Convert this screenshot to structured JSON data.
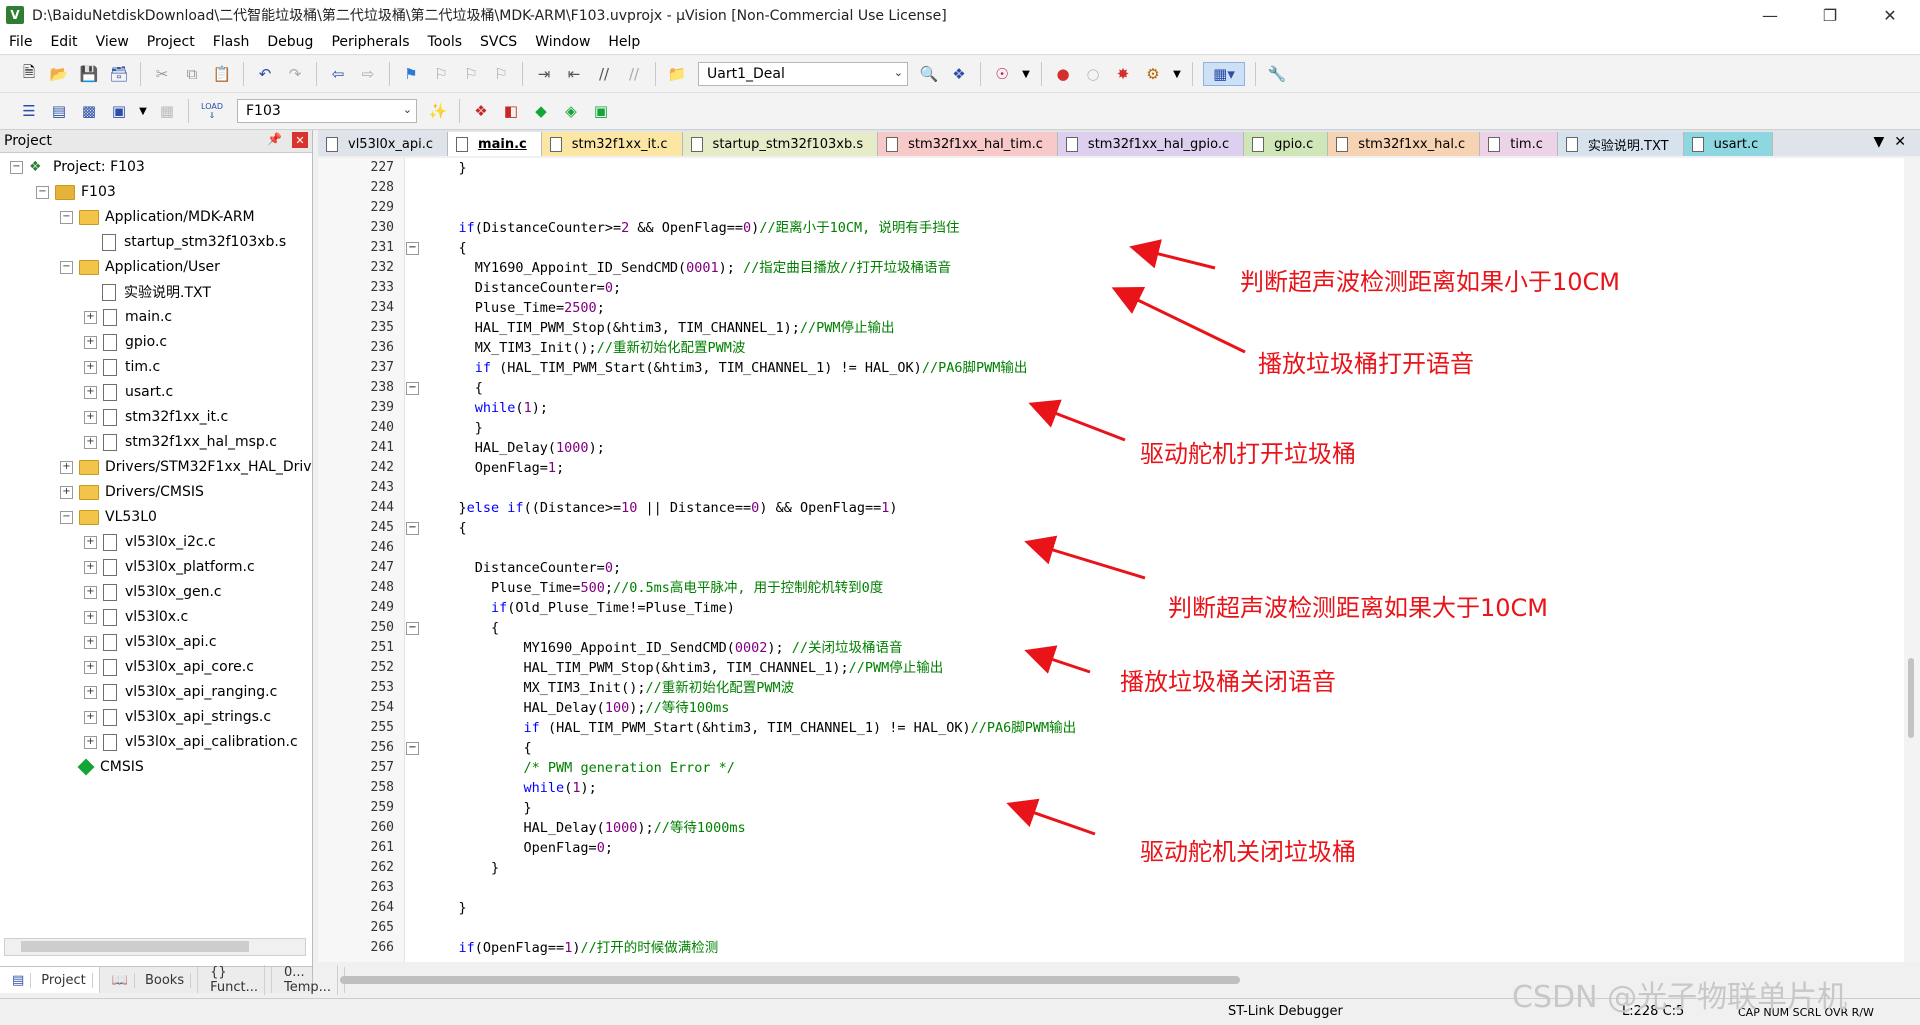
{
  "window": {
    "title": "D:\\BaiduNetdiskDownload\\二代智能垃圾桶\\第二代垃圾桶\\第二代垃圾桶\\MDK-ARM\\F103.uvprojx - µVision  [Non-Commercial Use License]",
    "app_icon": "V"
  },
  "menu": [
    "File",
    "Edit",
    "View",
    "Project",
    "Flash",
    "Debug",
    "Peripherals",
    "Tools",
    "SVCS",
    "Window",
    "Help"
  ],
  "toolbar": {
    "function_combo": "Uart1_Deal",
    "target_combo": "F103",
    "load_label": "LOAD"
  },
  "project_panel": {
    "title": "Project",
    "tree": [
      {
        "label": "Project: F103",
        "icon": "project-icon"
      },
      {
        "label": "F103",
        "icon": "target-folder-icon"
      },
      {
        "label": "Application/MDK-ARM",
        "icon": "folder-icon"
      },
      {
        "label": "startup_stm32f103xb.s",
        "icon": "file-icon"
      },
      {
        "label": "Application/User",
        "icon": "folder-icon"
      },
      {
        "label": "实验说明.TXT",
        "icon": "file-icon"
      },
      {
        "label": "main.c",
        "icon": "file-icon"
      },
      {
        "label": "gpio.c",
        "icon": "file-icon"
      },
      {
        "label": "tim.c",
        "icon": "file-icon"
      },
      {
        "label": "usart.c",
        "icon": "file-icon"
      },
      {
        "label": "stm32f1xx_it.c",
        "icon": "file-icon"
      },
      {
        "label": "stm32f1xx_hal_msp.c",
        "icon": "file-icon"
      },
      {
        "label": "Drivers/STM32F1xx_HAL_Drive",
        "icon": "folder-icon"
      },
      {
        "label": "Drivers/CMSIS",
        "icon": "folder-icon"
      },
      {
        "label": "VL53L0",
        "icon": "folder-icon"
      },
      {
        "label": "vl53l0x_i2c.c",
        "icon": "file-icon"
      },
      {
        "label": "vl53l0x_platform.c",
        "icon": "file-icon"
      },
      {
        "label": "vl53l0x_gen.c",
        "icon": "file-icon"
      },
      {
        "label": "vl53l0x.c",
        "icon": "file-icon"
      },
      {
        "label": "vl53l0x_api.c",
        "icon": "file-icon"
      },
      {
        "label": "vl53l0x_api_core.c",
        "icon": "file-icon"
      },
      {
        "label": "vl53l0x_api_ranging.c",
        "icon": "file-icon"
      },
      {
        "label": "vl53l0x_api_strings.c",
        "icon": "file-icon"
      },
      {
        "label": "vl53l0x_api_calibration.c",
        "icon": "file-icon"
      },
      {
        "label": "CMSIS",
        "icon": "cmsis-icon"
      }
    ],
    "bottom_tabs": [
      "Project",
      "Books",
      "{} Funct...",
      "0... Temp..."
    ]
  },
  "editor_tabs": [
    {
      "label": "vl53l0x_api.c",
      "color": "#dfe3ea"
    },
    {
      "label": "main.c",
      "color": "#ffffff",
      "active": true
    },
    {
      "label": "stm32f1xx_it.c",
      "color": "#fbe7a3"
    },
    {
      "label": "startup_stm32f103xb.s",
      "color": "#e6ecc8"
    },
    {
      "label": "stm32f1xx_hal_tim.c",
      "color": "#f7c9c9"
    },
    {
      "label": "stm32f1xx_hal_gpio.c",
      "color": "#dcd0ee"
    },
    {
      "label": "gpio.c",
      "color": "#cfe6b8"
    },
    {
      "label": "stm32f1xx_hal.c",
      "color": "#f6d3b3"
    },
    {
      "label": "tim.c",
      "color": "#ecd3e8"
    },
    {
      "label": "实验说明.TXT",
      "color": "#d6e3ef"
    },
    {
      "label": "usart.c",
      "color": "#8fd7e0"
    }
  ],
  "code_lines": [
    {
      "n": "227",
      "t": "    }"
    },
    {
      "n": "228",
      "t": ""
    },
    {
      "n": "229",
      "t": ""
    },
    {
      "n": "230",
      "t": "    if(DistanceCounter>=2 && OpenFlag==0)//距离小于10CM, 说明有手挡住"
    },
    {
      "n": "231",
      "t": "    {",
      "fold": true
    },
    {
      "n": "232",
      "t": "      MY1690_Appoint_ID_SendCMD(0001); //指定曲目播放//打开垃圾桶语音"
    },
    {
      "n": "233",
      "t": "      DistanceCounter=0;"
    },
    {
      "n": "234",
      "t": "      Pluse_Time=2500;"
    },
    {
      "n": "235",
      "t": "      HAL_TIM_PWM_Stop(&htim3, TIM_CHANNEL_1);//PWM停止输出"
    },
    {
      "n": "236",
      "t": "      MX_TIM3_Init();//重新初始化配置PWM波"
    },
    {
      "n": "237",
      "t": "      if (HAL_TIM_PWM_Start(&htim3, TIM_CHANNEL_1) != HAL_OK)//PA6脚PWM输出"
    },
    {
      "n": "238",
      "t": "      {",
      "fold": true
    },
    {
      "n": "239",
      "t": "      while(1);"
    },
    {
      "n": "240",
      "t": "      }"
    },
    {
      "n": "241",
      "t": "      HAL_Delay(1000);"
    },
    {
      "n": "242",
      "t": "      OpenFlag=1;"
    },
    {
      "n": "243",
      "t": ""
    },
    {
      "n": "244",
      "t": "    }else if((Distance>=10 || Distance==0) && OpenFlag==1)"
    },
    {
      "n": "245",
      "t": "    {",
      "fold": true
    },
    {
      "n": "246",
      "t": ""
    },
    {
      "n": "247",
      "t": "      DistanceCounter=0;"
    },
    {
      "n": "248",
      "t": "        Pluse_Time=500;//0.5ms高电平脉冲, 用于控制舵机转到0度"
    },
    {
      "n": "249",
      "t": "        if(Old_Pluse_Time!=Pluse_Time)"
    },
    {
      "n": "250",
      "t": "        {",
      "fold": true
    },
    {
      "n": "251",
      "t": "            MY1690_Appoint_ID_SendCMD(0002); //关闭垃圾桶语音"
    },
    {
      "n": "252",
      "t": "            HAL_TIM_PWM_Stop(&htim3, TIM_CHANNEL_1);//PWM停止输出"
    },
    {
      "n": "253",
      "t": "            MX_TIM3_Init();//重新初始化配置PWM波"
    },
    {
      "n": "254",
      "t": "            HAL_Delay(100);//等待100ms"
    },
    {
      "n": "255",
      "t": "            if (HAL_TIM_PWM_Start(&htim3, TIM_CHANNEL_1) != HAL_OK)//PA6脚PWM输出"
    },
    {
      "n": "256",
      "t": "            {",
      "fold": true
    },
    {
      "n": "257",
      "t": "            /* PWM generation Error */"
    },
    {
      "n": "258",
      "t": "            while(1);"
    },
    {
      "n": "259",
      "t": "            }"
    },
    {
      "n": "260",
      "t": "            HAL_Delay(1000);//等待1000ms"
    },
    {
      "n": "261",
      "t": "            OpenFlag=0;"
    },
    {
      "n": "262",
      "t": "        }"
    },
    {
      "n": "263",
      "t": ""
    },
    {
      "n": "264",
      "t": "    }"
    },
    {
      "n": "265",
      "t": ""
    },
    {
      "n": "266",
      "t": "    if(OpenFlag==1)//打开的时候做满检测"
    }
  ],
  "annotations": [
    "判断超声波检测距离如果小于10CM",
    "播放垃圾桶打开语音",
    "驱动舵机打开垃圾桶",
    "判断超声波检测距离如果大于10CM",
    "播放垃圾桶关闭语音",
    "驱动舵机关闭垃圾桶"
  ],
  "status": {
    "debugger": "ST-Link Debugger",
    "position": "L:228 C:5",
    "flags": "CAP  NUM  SCRL  OVR  R/W"
  },
  "watermark": "CSDN @光子物联单片机",
  "colors": {
    "keyword": "#0000ff",
    "comment": "#008000",
    "number": "#800080",
    "annotation": "#e8141a"
  }
}
